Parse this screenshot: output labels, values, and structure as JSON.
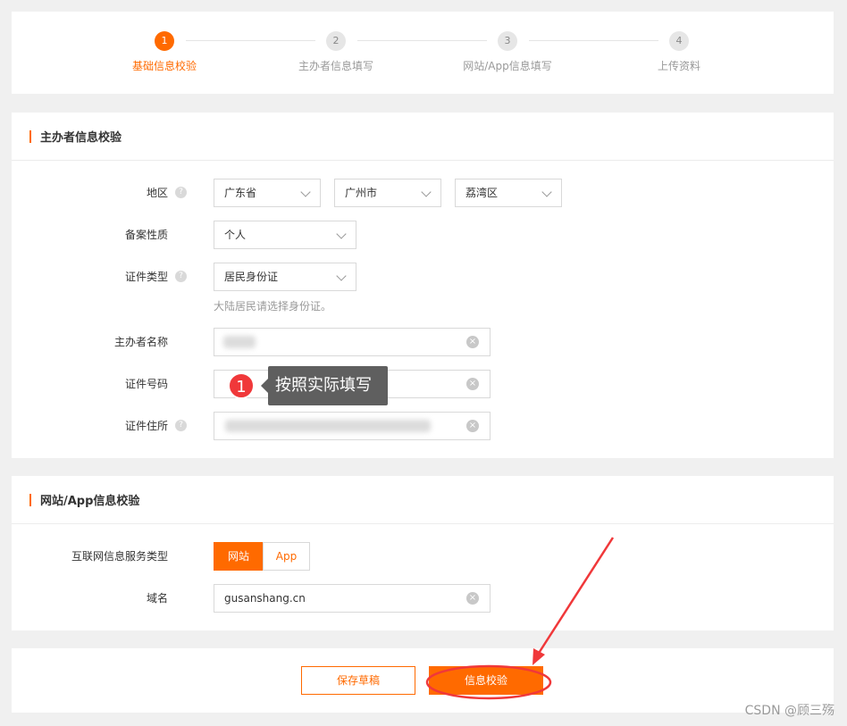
{
  "steps": [
    {
      "num": "1",
      "label": "基础信息校验",
      "active": true
    },
    {
      "num": "2",
      "label": "主办者信息填写",
      "active": false
    },
    {
      "num": "3",
      "label": "网站/App信息填写",
      "active": false
    },
    {
      "num": "4",
      "label": "上传资料",
      "active": false
    }
  ],
  "sponsor": {
    "title": "主办者信息校验",
    "region_label": "地区",
    "province": "广东省",
    "city": "广州市",
    "district": "荔湾区",
    "nature_label": "备案性质",
    "nature": "个人",
    "id_type_label": "证件类型",
    "id_type": "居民身份证",
    "id_hint": "大陆居民请选择身份证。",
    "name_label": "主办者名称",
    "id_number_label": "证件号码",
    "address_label": "证件住所"
  },
  "tooltip": {
    "badge": "1",
    "text": "按照实际填写"
  },
  "website": {
    "title": "网站/App信息校验",
    "service_type_label": "互联网信息服务类型",
    "option_website": "网站",
    "option_app": "App",
    "domain_label": "域名",
    "domain_value": "gusanshang.cn"
  },
  "actions": {
    "save_draft": "保存草稿",
    "verify": "信息校验"
  },
  "watermark": "CSDN @顾三殇",
  "colors": {
    "accent": "#ff6a00",
    "annotation": "#f0383a"
  },
  "icons": {
    "help": "question-circle-icon",
    "clear": "close-circle-icon",
    "dropdown": "chevron-down-icon"
  }
}
